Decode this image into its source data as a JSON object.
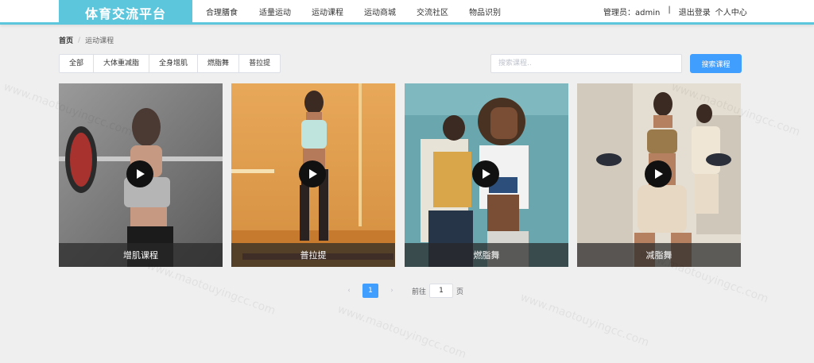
{
  "header": {
    "brand": "体育交流平台",
    "nav": [
      "合理膳食",
      "适量运动",
      "运动课程",
      "运动商城",
      "交流社区",
      "物品识别"
    ],
    "user_prefix": "管理员：",
    "username": "admin",
    "separator": "|",
    "logout": "退出登录",
    "profile": "个人中心"
  },
  "breadcrumb": {
    "home": "首页",
    "separator": "/",
    "current": "运动课程"
  },
  "tabs": [
    "全部",
    "大体重减脂",
    "全身增肌",
    "燃脂舞",
    "普拉提"
  ],
  "search": {
    "placeholder": "搜索课程..",
    "button": "搜索课程"
  },
  "cards": [
    {
      "title": "增肌课程",
      "icon": "play-icon"
    },
    {
      "title": "普拉提",
      "icon": "play-icon"
    },
    {
      "title": "燃脂舞",
      "icon": "play-icon"
    },
    {
      "title": "减脂舞",
      "icon": "play-icon"
    }
  ],
  "pagination": {
    "prev": "‹",
    "next": "›",
    "current_page": "1",
    "goto_label": "前往",
    "goto_value": "1",
    "page_suffix": "页"
  },
  "colors": {
    "accent": "#5cc6dd",
    "primary_button": "#409eff",
    "background": "#efefef"
  },
  "watermark": "www.maotouyingcc.com"
}
